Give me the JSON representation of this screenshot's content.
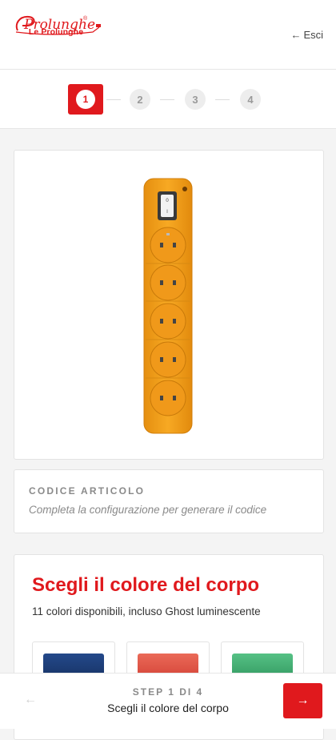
{
  "header": {
    "logo_script": "Prolunghe",
    "logo_registered": "®",
    "logo_sub": "Le Prolunghe",
    "exit_icon": "arrow-left-icon",
    "exit_label": "Esci"
  },
  "stepper": {
    "steps": [
      "1",
      "2",
      "3",
      "4"
    ],
    "active": 1
  },
  "product": {
    "image": "orange-power-strip-5-sockets-with-switch",
    "switch_marks": [
      "0",
      "I"
    ]
  },
  "code": {
    "label": "CODICE ARTICOLO",
    "placeholder": "Completa la configurazione per generare il codice"
  },
  "color_section": {
    "title": "Scegli il colore del corpo",
    "subtitle": "11 colori disponibili, incluso Ghost luminescente",
    "swatches": [
      {
        "color": "#1d3c72"
      },
      {
        "color": "#e05346"
      },
      {
        "color": "#3aa86a"
      }
    ]
  },
  "footer": {
    "prev_icon": "arrow-left-icon",
    "step_count": "STEP 1 DI 4",
    "step_name": "Scegli il colore del corpo",
    "next_icon": "arrow-right-icon"
  },
  "colors": {
    "brand_red": "#e0191d",
    "body_orange": "#f5a21c"
  }
}
